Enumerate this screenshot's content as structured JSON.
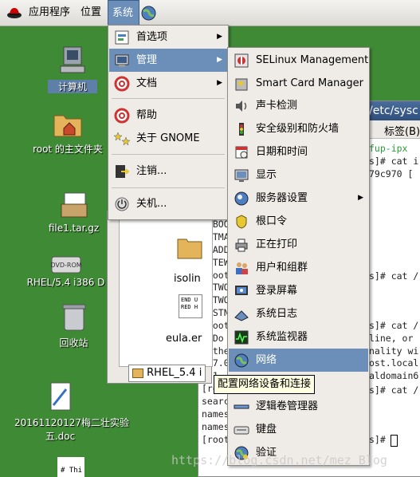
{
  "panel": {
    "menus": [
      "应用程序",
      "位置",
      "系统"
    ],
    "active_menu": "系统"
  },
  "desktop": {
    "icons": [
      {
        "label": "计算机",
        "icon": "computer-icon"
      },
      {
        "label": "root 的主文件夹",
        "icon": "home-folder-icon"
      },
      {
        "label": "file1.tar.gz",
        "icon": "archive-icon"
      },
      {
        "label": "RHEL/5.4 i386 D",
        "icon": "dvd-icon"
      },
      {
        "label": "回收站",
        "icon": "trash-icon"
      },
      {
        "label": "20161120127梅二壮实验",
        "label2": "五.doc",
        "icon": "document-icon"
      },
      {
        "label": "# Thi",
        "icon": "text-file-icon"
      }
    ]
  },
  "terminal": {
    "title": "/etc/sysc",
    "menu_item": "标签(B)",
    "lines": [
      "fup-ipx",
      "s]# cat i",
      "  79c970 [",
      "ONBOO",
      "NETMA",
      "IPADD",
      "GATEW",
      "[root",
      "NETWO",
      "NETWO",
      "HOSTN",
      "[root",
      "# Do",
      "# the",
      "127.0",
      "::1",
      "[root",
      "searc",
      "names",
      "names",
      "[root"
    ],
    "right_lines": [
      "s]# cat /",
      "s]# cat /",
      "line, or",
      "nality wi",
      "ost.local",
      "aldomain6",
      "s]# cat /",
      "s]# "
    ]
  },
  "filewin": {
    "items": [
      "isolin",
      "eula.er"
    ],
    "tab_label": "RHEL_5.4 i",
    "eula_text": [
      "END U",
      "RED H"
    ]
  },
  "system_menu": {
    "items": [
      {
        "label": "首选项",
        "icon": "preferences-icon",
        "submenu": true
      },
      {
        "label": "管理",
        "icon": "administration-icon",
        "submenu": true
      },
      {
        "label": "文档",
        "icon": "help-docs-icon",
        "submenu": true
      },
      {
        "label": "帮助",
        "icon": "help-icon",
        "submenu": false
      },
      {
        "label": "关于 GNOME",
        "icon": "gnome-icon",
        "submenu": false
      },
      {
        "label": "注销...",
        "icon": "logout-icon",
        "submenu": false
      },
      {
        "label": "关机...",
        "icon": "shutdown-icon",
        "submenu": false
      }
    ]
  },
  "admin_menu": {
    "items": [
      {
        "label": "SELinux Management",
        "icon": "selinux-icon"
      },
      {
        "label": "Smart Card Manager",
        "icon": "smartcard-icon"
      },
      {
        "label": "声卡检测",
        "icon": "soundcard-icon"
      },
      {
        "label": "安全级别和防火墙",
        "icon": "firewall-icon"
      },
      {
        "label": "日期和时间",
        "icon": "datetime-icon"
      },
      {
        "label": "显示",
        "icon": "display-icon"
      },
      {
        "label": "服务器设置",
        "icon": "server-icon",
        "submenu": true
      },
      {
        "label": "根口令",
        "icon": "root-password-icon"
      },
      {
        "label": "正在打印",
        "icon": "printer-icon"
      },
      {
        "label": "用户和组群",
        "icon": "users-icon"
      },
      {
        "label": "登录屏幕",
        "icon": "login-screen-icon"
      },
      {
        "label": "系统日志",
        "icon": "system-log-icon"
      },
      {
        "label": "系统监视器",
        "icon": "system-monitor-icon"
      },
      {
        "label": "网络",
        "icon": "network-icon",
        "highlighted": true
      },
      {
        "label": "逻辑卷管理器",
        "icon": "lvm-icon"
      },
      {
        "label": "键盘",
        "icon": "keyboard-icon"
      },
      {
        "label": "验证",
        "icon": "authentication-icon"
      }
    ]
  },
  "tooltip": "配置网络设备和连接",
  "watermark": "https://blog.csdn.net/mez_Blog"
}
